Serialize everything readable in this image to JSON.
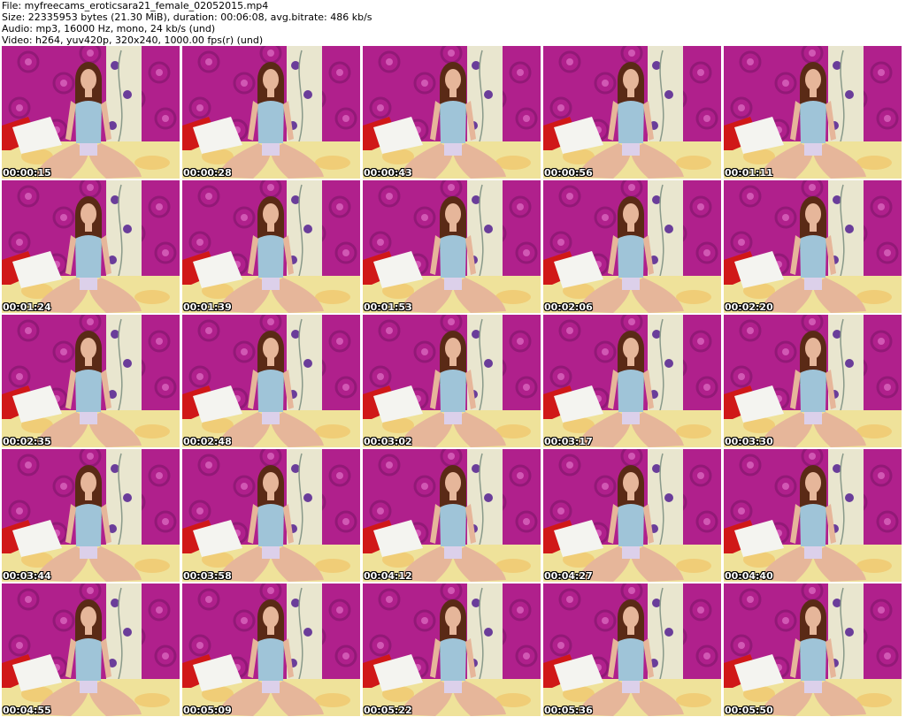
{
  "header": {
    "file_line": "File: myfreecams_eroticsara21_female_02052015.mp4",
    "size_line": "Size: 22335953 bytes (21.30 MiB), duration: 00:06:08, avg.bitrate: 486 kb/s",
    "audio_line": "Audio: mp3, 16000 Hz, mono, 24 kb/s (und)",
    "video_line": "Video: h264, yuv420p, 320x240, 1000.00 fps(r) (und)"
  },
  "colors": {
    "wallpaper": "#b0208c",
    "wallpaper_dark": "#7a1466",
    "light_wall": "#e9e6cf",
    "flower_purple": "#6a3d9a",
    "bedding": "#efe29a",
    "pillow_red": "#d01818",
    "pillow_white": "#f4f4f0",
    "skin": "#e6b69a",
    "hair": "#5a2a16",
    "top": "#9fc4d8"
  },
  "thumbnails": [
    {
      "timestamp": "00:00:15"
    },
    {
      "timestamp": "00:00:28"
    },
    {
      "timestamp": "00:00:43"
    },
    {
      "timestamp": "00:00:56"
    },
    {
      "timestamp": "00:01:11"
    },
    {
      "timestamp": "00:01:24"
    },
    {
      "timestamp": "00:01:39"
    },
    {
      "timestamp": "00:01:53"
    },
    {
      "timestamp": "00:02:06"
    },
    {
      "timestamp": "00:02:20"
    },
    {
      "timestamp": "00:02:35"
    },
    {
      "timestamp": "00:02:48"
    },
    {
      "timestamp": "00:03:02"
    },
    {
      "timestamp": "00:03:17"
    },
    {
      "timestamp": "00:03:30"
    },
    {
      "timestamp": "00:03:44"
    },
    {
      "timestamp": "00:03:58"
    },
    {
      "timestamp": "00:04:12"
    },
    {
      "timestamp": "00:04:27"
    },
    {
      "timestamp": "00:04:40"
    },
    {
      "timestamp": "00:04:55"
    },
    {
      "timestamp": "00:05:09"
    },
    {
      "timestamp": "00:05:22"
    },
    {
      "timestamp": "00:05:36"
    },
    {
      "timestamp": "00:05:50"
    }
  ]
}
